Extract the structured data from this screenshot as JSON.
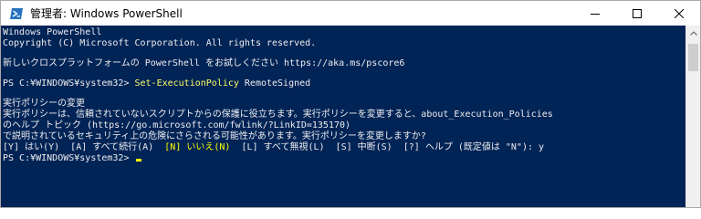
{
  "window": {
    "title": "管理者: Windows PowerShell",
    "controls": {
      "minimize": "—",
      "maximize": "☐",
      "close": "✕"
    },
    "accent": "#012456"
  },
  "console": {
    "lines": {
      "l1": "Windows PowerShell",
      "l2": "Copyright (C) Microsoft Corporation. All rights reserved.",
      "l3": "新しいクロスプラットフォームの PowerShell をお試しください https://aka.ms/pscore6",
      "l4_prompt": "PS C:¥WINDOWS¥system32> ",
      "l4_cmd": "Set-ExecutionPolicy",
      "l4_arg": " RemoteSigned",
      "l5": "実行ポリシーの変更",
      "l6": "実行ポリシーは、信頼されていないスクリプトからの保護に役立ちます。実行ポリシーを変更すると、about_Execution_Policies",
      "l7": "のヘルプ トピック (https://go.microsoft.com/fwlink/?LinkID=135170)",
      "l8": "で説明されているセキュリティ上の危険にさらされる可能性があります。実行ポリシーを変更しますか?",
      "l9_a": "[Y] はい(Y)  [A] すべて続行(A)  ",
      "l9_hl": "[N] いいえ(N)",
      "l9_b": "  [L] すべて無視(L)  [S] 中断(S)  [?] ヘルプ (既定値は \"N\"): y",
      "l10_prompt": "PS C:¥WINDOWS¥system32> "
    }
  }
}
